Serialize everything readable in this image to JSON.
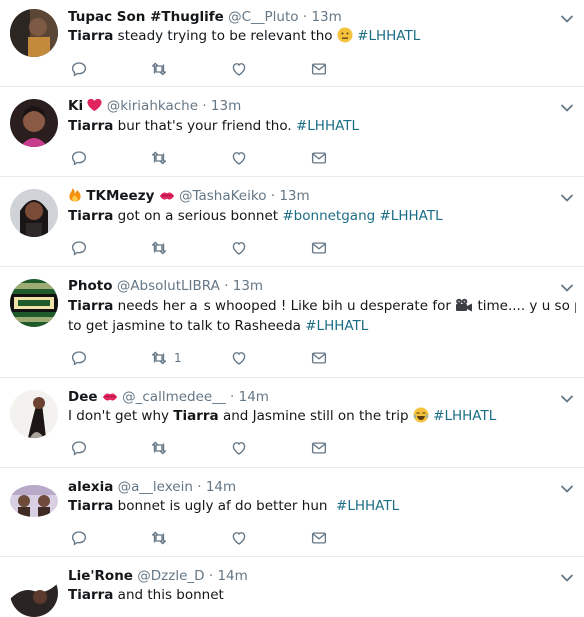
{
  "colors": {
    "accent": "#1b6d85",
    "muted": "#657786",
    "divider": "#e6ecf0"
  },
  "tweets": [
    {
      "name": "Tupac Son #Thuglife",
      "handle": "@C__Pluto",
      "sep": "·",
      "time": "13m",
      "mention": "Tiarra",
      "text": " steady trying to be relevant tho ",
      "emoji": "neutral-face-icon",
      "hashtag": "#LHHATL",
      "retweets": ""
    },
    {
      "name": "Ki",
      "name_emoji": "heart-icon",
      "handle": "@kiriahkache",
      "sep": "·",
      "time": "13m",
      "mention": "Tiarra",
      "text": " bur that's your friend tho. ",
      "hashtag": "#LHHATL",
      "retweets": ""
    },
    {
      "name_emoji_pre": "fire-icon",
      "name": "TKMeezy",
      "name_emoji": "kiss-icon",
      "handle": "@TashaKeiko",
      "sep": "·",
      "time": "13m",
      "mention": "Tiarra",
      "text": " got on a serious bonnet ",
      "hashtag1": "#bonnetgang",
      "hashtag": "#LHHATL",
      "retweets": ""
    },
    {
      "name": "Photo",
      "handle": "@AbsolutLIBRA",
      "sep": "·",
      "time": "13m",
      "mention": "Tiarra",
      "text_line1_a": " needs her a",
      "text_line1_b": "s whooped ! Like bih u desperate for ",
      "text_line1_c": " time.... y u so pressed",
      "text_line2": "to get jasmine to talk to Rasheeda ",
      "hashtag": "#LHHATL",
      "retweets": "1"
    },
    {
      "name": "Dee",
      "name_emoji": "kiss-icon",
      "handle": "@_callmedee__",
      "sep": "·",
      "time": "14m",
      "text_pre": "I don't get why ",
      "mention": "Tiarra",
      "text": " and Jasmine still on the trip ",
      "emoji": "joy-icon",
      "hashtag": "#LHHATL",
      "retweets": ""
    },
    {
      "name": "alexia",
      "handle": "@a__lexein",
      "sep": "·",
      "time": "14m",
      "mention": "Tiarra",
      "text": " bonnet is ugly af do better hun  ",
      "hashtag": "#LHHATL",
      "retweets": ""
    },
    {
      "name": "Lie'Rone",
      "handle": "@Dzzle_D",
      "sep": "·",
      "time": "14m",
      "mention": "Tiarra",
      "text": " and this bonnet"
    }
  ]
}
